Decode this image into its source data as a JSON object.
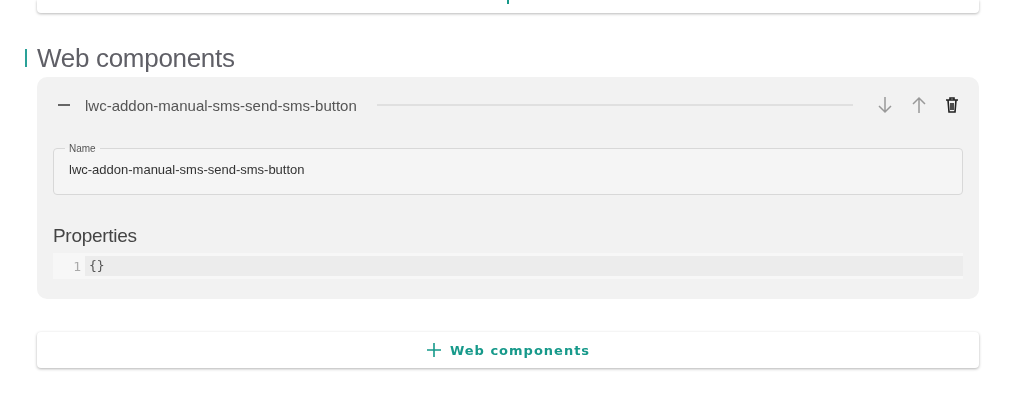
{
  "section": {
    "title": "Web components"
  },
  "components": [
    {
      "title": "lwc-addon-manual-sms-send-sms-button",
      "expanded": true,
      "name_field": {
        "label": "Name",
        "value": "lwc-addon-manual-sms-send-sms-button"
      },
      "properties": {
        "label": "Properties",
        "lines": [
          {
            "number": "1",
            "text": "{}"
          }
        ]
      }
    }
  ],
  "add_button": {
    "label": "Web components"
  }
}
